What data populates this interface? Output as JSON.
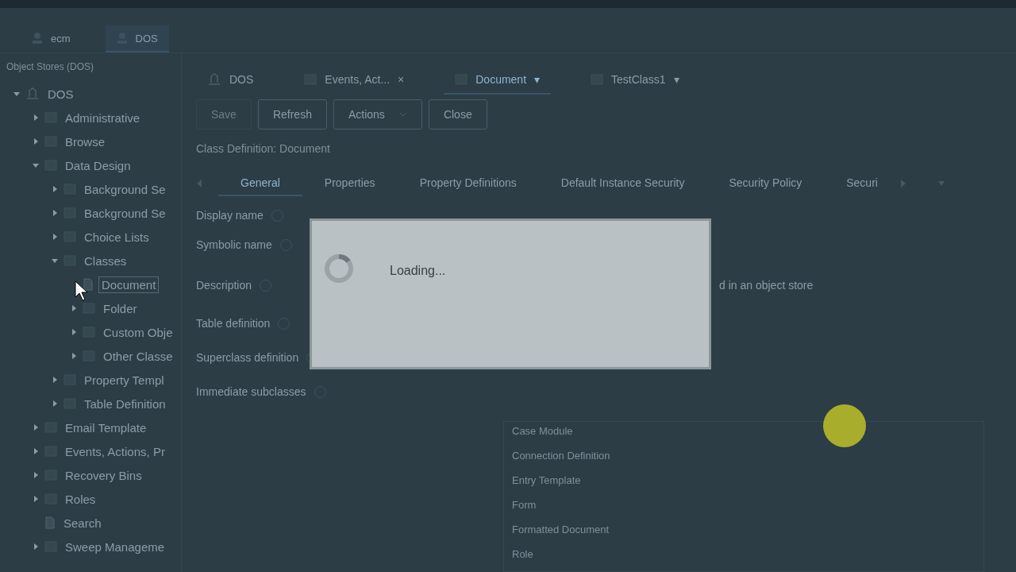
{
  "header_tabs": [
    {
      "label": "ecm",
      "selected": false
    },
    {
      "label": "DOS",
      "selected": true
    }
  ],
  "sidebar": {
    "title": "Object Stores (DOS)",
    "tree": [
      {
        "label": "DOS",
        "kind": "store",
        "expanded": true,
        "selected": false,
        "children": [
          {
            "label": "Administrative",
            "kind": "folder",
            "expanded": false,
            "selected": false
          },
          {
            "label": "Browse",
            "kind": "folder",
            "expanded": false,
            "selected": false
          },
          {
            "label": "Data Design",
            "kind": "folder",
            "expanded": true,
            "selected": false,
            "children": [
              {
                "label": "Background Se",
                "kind": "folder",
                "expanded": false,
                "selected": false
              },
              {
                "label": "Background Se",
                "kind": "folder",
                "expanded": false,
                "selected": false
              },
              {
                "label": "Choice Lists",
                "kind": "folder",
                "expanded": false,
                "selected": false
              },
              {
                "label": "Classes",
                "kind": "folder",
                "expanded": true,
                "selected": false,
                "children": [
                  {
                    "label": "Document",
                    "kind": "leaf",
                    "selected": true
                  },
                  {
                    "label": "Folder",
                    "kind": "folder",
                    "expanded": false,
                    "selected": false
                  },
                  {
                    "label": "Custom Obje",
                    "kind": "folder",
                    "expanded": false,
                    "selected": false
                  },
                  {
                    "label": "Other Classe",
                    "kind": "folder",
                    "expanded": false,
                    "selected": false
                  }
                ]
              },
              {
                "label": "Property Templ",
                "kind": "folder",
                "expanded": false,
                "selected": false
              },
              {
                "label": "Table Definition",
                "kind": "folder",
                "expanded": false,
                "selected": false
              }
            ]
          },
          {
            "label": "Email Template",
            "kind": "folder",
            "expanded": false,
            "selected": false
          },
          {
            "label": "Events, Actions, Pr",
            "kind": "folder",
            "expanded": false,
            "selected": false
          },
          {
            "label": "Recovery Bins",
            "kind": "folder",
            "expanded": false,
            "selected": false
          },
          {
            "label": "Roles",
            "kind": "folder",
            "expanded": false,
            "selected": false
          },
          {
            "label": "Search",
            "kind": "leaf",
            "selected": false
          },
          {
            "label": "Sweep Manageme",
            "kind": "folder",
            "expanded": false,
            "selected": false
          }
        ]
      }
    ]
  },
  "doc_tabs": [
    {
      "label": "DOS",
      "selected": false
    },
    {
      "label": "Events, Act...",
      "selected": false,
      "menu": "×"
    },
    {
      "label": "Document",
      "selected": true,
      "menu": "▾"
    },
    {
      "label": "TestClass1",
      "selected": false,
      "menu": "▾"
    }
  ],
  "toolbar": [
    {
      "label": "Save",
      "disabled": true
    },
    {
      "label": "Refresh",
      "disabled": false
    },
    {
      "label": "Actions",
      "disabled": false,
      "caret": true
    },
    {
      "label": "Close",
      "disabled": false
    }
  ],
  "heading": "Class Definition: Document",
  "prop_tabs": [
    {
      "label": "General",
      "selected": true
    },
    {
      "label": "Properties",
      "selected": false
    },
    {
      "label": "Property Definitions",
      "selected": false
    },
    {
      "label": "Default Instance Security",
      "selected": false
    },
    {
      "label": "Security Policy",
      "selected": false
    },
    {
      "label": "Securi",
      "selected": false
    }
  ],
  "form": [
    {
      "label": "Display name"
    },
    {
      "label": "Symbolic name"
    },
    {
      "label": "Description",
      "value": "d in an object store"
    },
    {
      "label": "Table definition"
    },
    {
      "label": "Superclass definition"
    },
    {
      "label": "Immediate subclasses"
    }
  ],
  "subclasses": [
    "Case Module",
    "Connection Definition",
    "Entry Template",
    "Form",
    "Formatted Document",
    "Role"
  ],
  "dialog": {
    "message": "Loading..."
  }
}
